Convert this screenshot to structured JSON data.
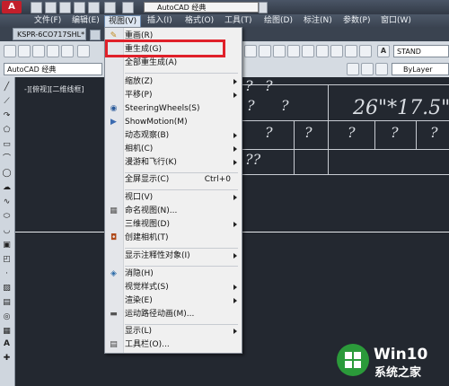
{
  "titlebar": {
    "workspace": "AutoCAD 经典"
  },
  "menubar": {
    "items": [
      {
        "label": "文件(F)"
      },
      {
        "label": "编辑(E)"
      },
      {
        "label": "视图(V)"
      },
      {
        "label": "插入(I)"
      },
      {
        "label": "格式(O)"
      },
      {
        "label": "工具(T)"
      },
      {
        "label": "绘图(D)"
      },
      {
        "label": "标注(N)"
      },
      {
        "label": "参数(P)"
      },
      {
        "label": "窗口(W)"
      }
    ]
  },
  "tabs": {
    "document": "KSPR-6CO717SHL*"
  },
  "toolbar": {
    "workspace_combo": "AutoCAD 经典",
    "text_style": "STAND",
    "layer_combo": "ByLayer"
  },
  "canvas": {
    "viewport_label": "-][俯视][二维线框]",
    "texts": [
      "?",
      "?",
      "?",
      "?",
      "26\"*17.5\"",
      "?",
      "?",
      "?",
      "?",
      "?",
      "??"
    ]
  },
  "view_menu": {
    "items": [
      {
        "label": "重画(R)",
        "icon": "pencil-icon"
      },
      {
        "label": "重生成(G)"
      },
      {
        "label": "全部重生成(A)"
      },
      {
        "label": "缩放(Z)",
        "submenu": true
      },
      {
        "label": "平移(P)",
        "submenu": true
      },
      {
        "label": "SteeringWheels(S)",
        "icon": "steeringwheel-icon"
      },
      {
        "label": "ShowMotion(M)",
        "icon": "showmotion-icon"
      },
      {
        "label": "动态观察(B)",
        "submenu": true
      },
      {
        "label": "相机(C)",
        "submenu": true
      },
      {
        "label": "漫游和飞行(K)",
        "submenu": true
      },
      {
        "label": "全屏显示(C)",
        "shortcut": "Ctrl+0"
      },
      {
        "label": "视口(V)",
        "submenu": true
      },
      {
        "label": "命名视图(N)...",
        "icon": "namedview-icon"
      },
      {
        "label": "三维视图(D)",
        "submenu": true
      },
      {
        "label": "创建相机(T)",
        "icon": "camera-icon"
      },
      {
        "label": "显示注释性对象(I)",
        "submenu": true
      },
      {
        "label": "消隐(H)",
        "icon": "hide-icon"
      },
      {
        "label": "视觉样式(S)",
        "submenu": true
      },
      {
        "label": "渲染(E)",
        "submenu": true
      },
      {
        "label": "运动路径动画(M)...",
        "icon": "motionpath-icon"
      },
      {
        "label": "显示(L)",
        "submenu": true
      },
      {
        "label": "工具栏(O)...",
        "icon": "toolbar-icon"
      }
    ]
  },
  "watermark": {
    "line1": "Win10",
    "line2": "系统之家"
  },
  "colors": {
    "highlight": "#e0212a",
    "watermark_green": "#2b9a3a"
  }
}
